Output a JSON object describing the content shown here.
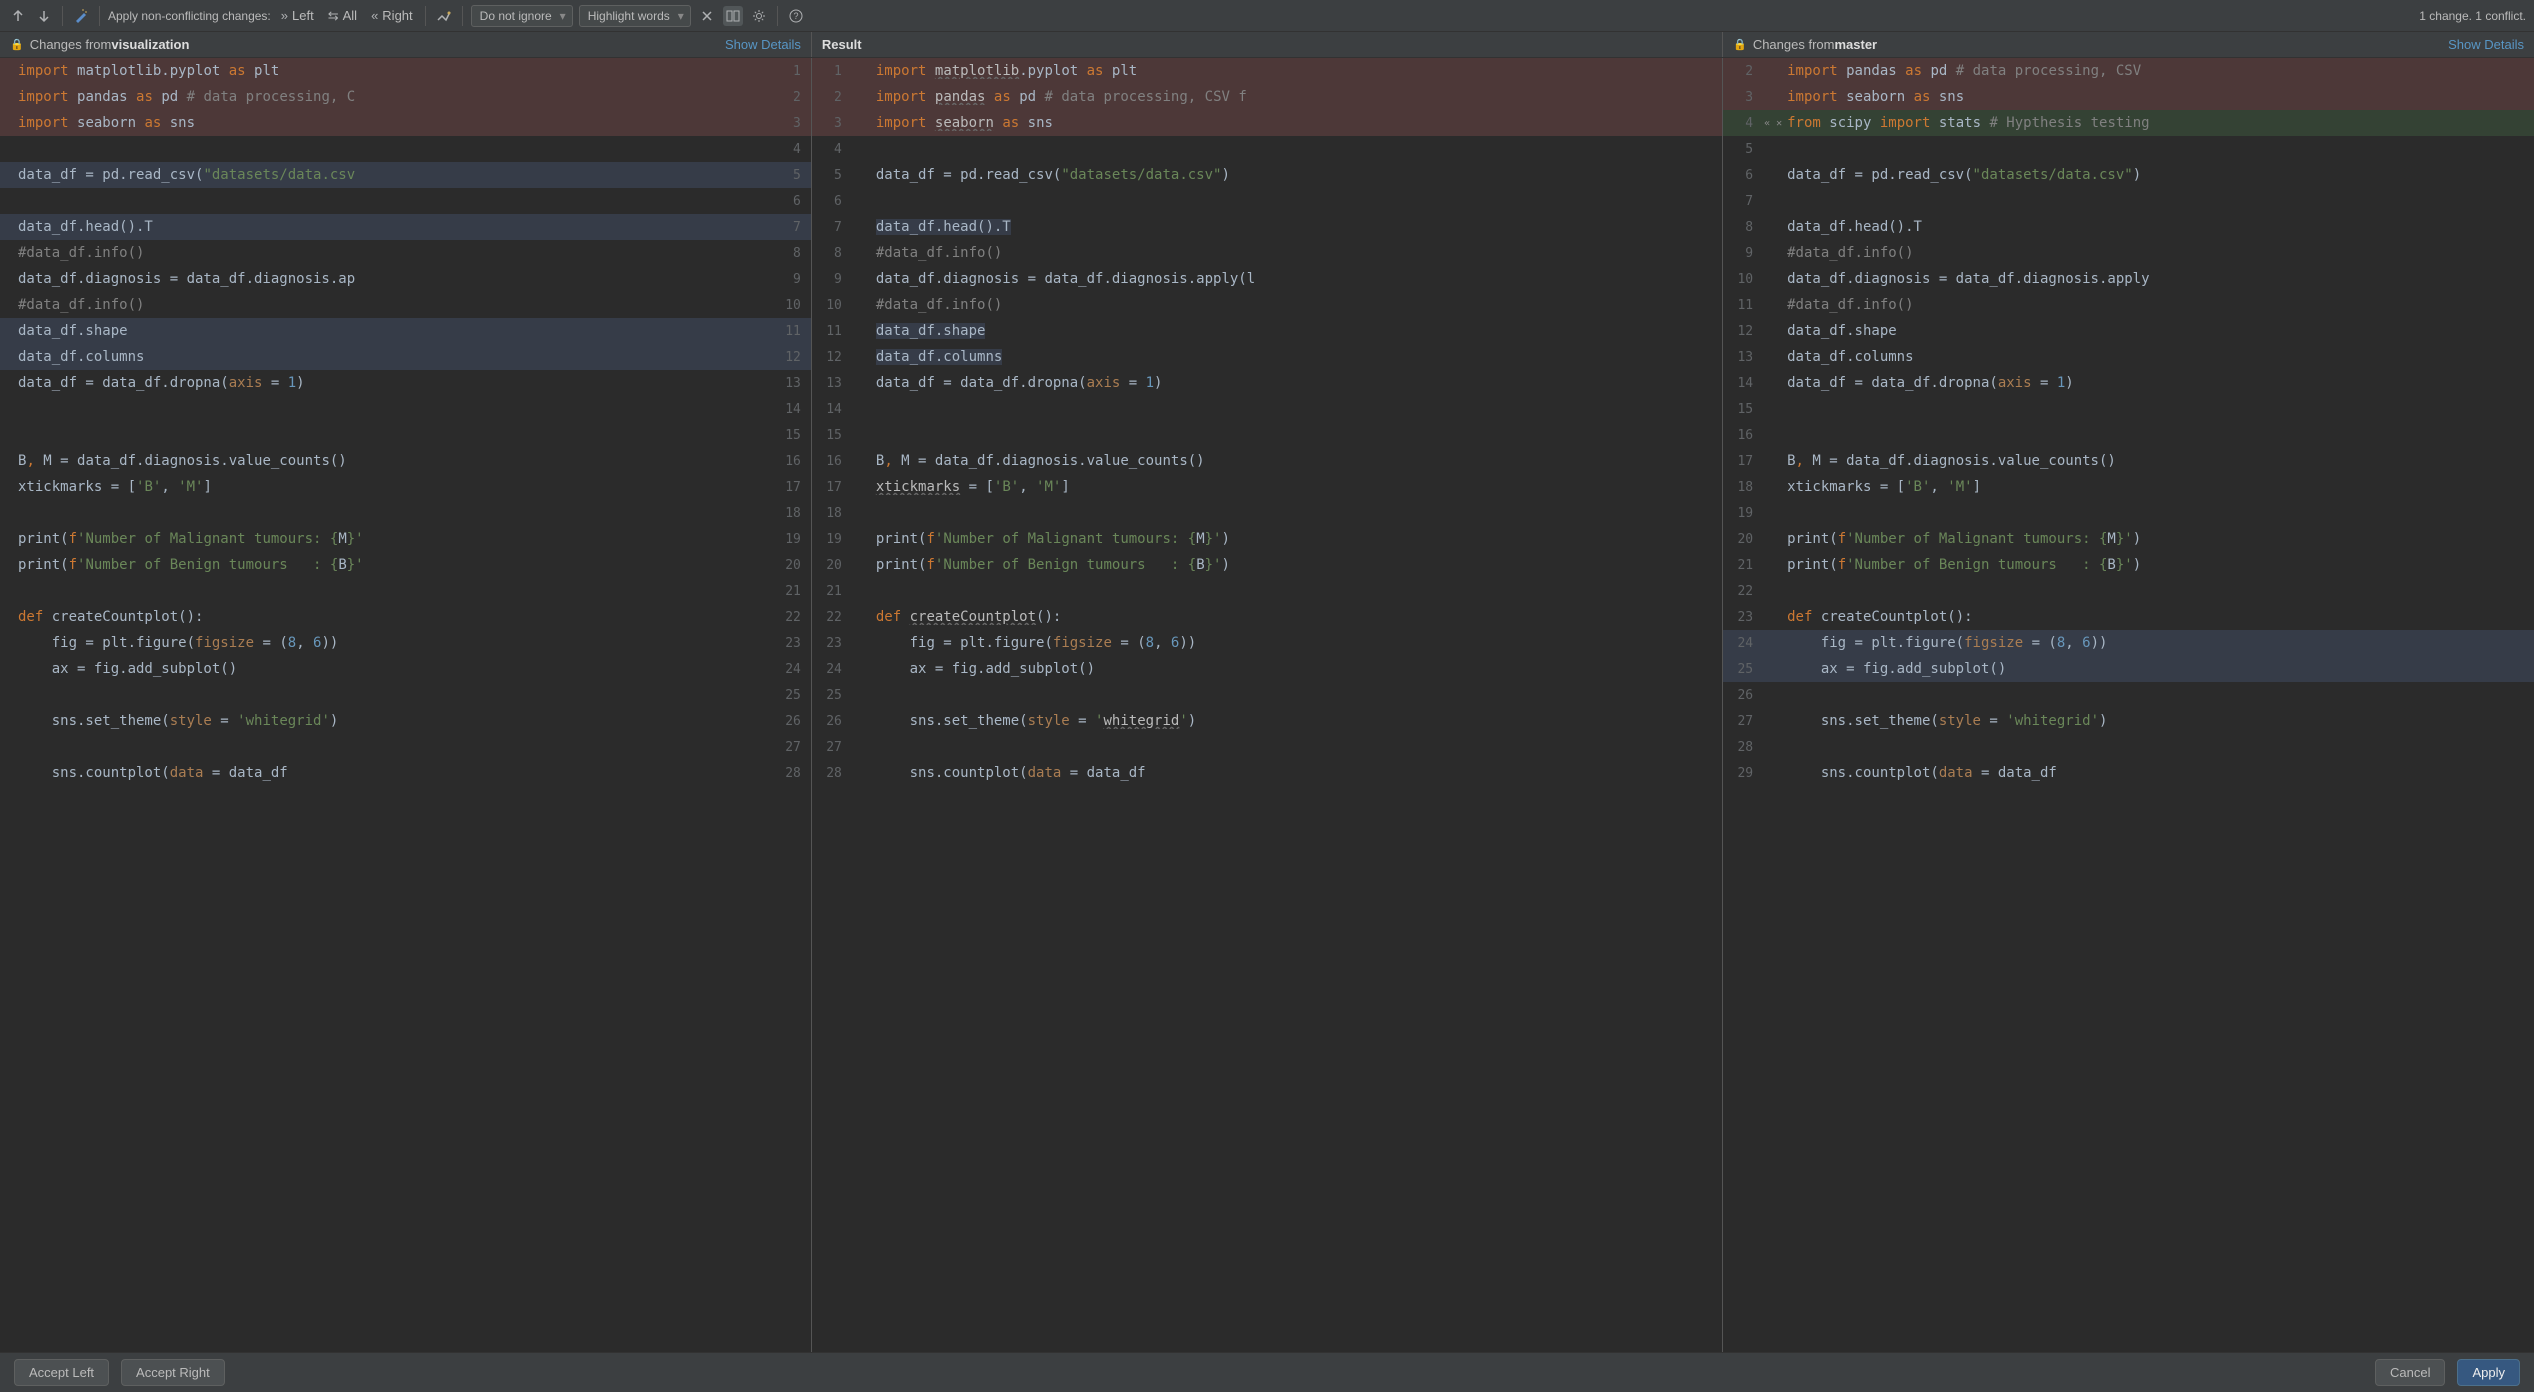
{
  "toolbar": {
    "apply_label": "Apply non-conflicting changes:",
    "left_label": "Left",
    "all_label": "All",
    "right_label": "Right",
    "ignore_dd": "Do not ignore",
    "highlight_dd": "Highlight words",
    "status": "1 change. 1 conflict."
  },
  "headers": {
    "left_prefix": "Changes from ",
    "left_branch": "visualization",
    "middle": "Result",
    "right_prefix": "Changes from ",
    "right_branch": "master",
    "show_details": "Show Details"
  },
  "left_lines": [
    {
      "n": 1,
      "bg": "conflict",
      "tokens": [
        [
          "kw",
          "import "
        ],
        [
          "ident",
          "matplotlib.pyplot "
        ],
        [
          "kw",
          "as "
        ],
        [
          "ident",
          "plt"
        ]
      ]
    },
    {
      "n": 2,
      "bg": "conflict",
      "tokens": [
        [
          "kw",
          "import "
        ],
        [
          "ident",
          "pandas "
        ],
        [
          "kw",
          "as "
        ],
        [
          "ident",
          "pd "
        ],
        [
          "comment",
          "# data processing, C"
        ]
      ]
    },
    {
      "n": 3,
      "bg": "conflict",
      "tokens": [
        [
          "kw",
          "import "
        ],
        [
          "ident",
          "seaborn "
        ],
        [
          "kw",
          "as "
        ],
        [
          "ident",
          "sns"
        ]
      ]
    },
    {
      "n": 4,
      "tokens": []
    },
    {
      "n": 5,
      "bg": "change",
      "tokens": [
        [
          "ident",
          "data_df = pd.read_csv("
        ],
        [
          "str",
          "\"datasets/data.csv"
        ]
      ]
    },
    {
      "n": 6,
      "tokens": []
    },
    {
      "n": 7,
      "bg": "change",
      "tokens": [
        [
          "ident",
          "data_df.head().T"
        ]
      ]
    },
    {
      "n": 8,
      "tokens": [
        [
          "comment",
          "#data_df.info()"
        ]
      ]
    },
    {
      "n": 9,
      "tokens": [
        [
          "ident",
          "data_df.diagnosis = data_df.diagnosis.ap"
        ]
      ]
    },
    {
      "n": 10,
      "tokens": [
        [
          "comment",
          "#data_df.info()"
        ]
      ]
    },
    {
      "n": 11,
      "bg": "change",
      "tokens": [
        [
          "ident",
          "data_df.shape"
        ]
      ]
    },
    {
      "n": 12,
      "bg": "change",
      "tokens": [
        [
          "ident",
          "data_df.columns"
        ]
      ]
    },
    {
      "n": 13,
      "tokens": [
        [
          "ident",
          "data_df = data_df.dropna("
        ],
        [
          "param",
          "axis"
        ],
        [
          "ident",
          " = "
        ],
        [
          "num",
          "1"
        ],
        [
          "ident",
          ")"
        ]
      ]
    },
    {
      "n": 14,
      "tokens": []
    },
    {
      "n": 15,
      "tokens": []
    },
    {
      "n": 16,
      "tokens": [
        [
          "ident",
          "B"
        ],
        [
          "kw",
          ", "
        ],
        [
          "ident",
          "M = data_df.diagnosis.value_counts()"
        ]
      ]
    },
    {
      "n": 17,
      "tokens": [
        [
          "ident",
          "xtickmarks = ["
        ],
        [
          "str",
          "'B'"
        ],
        [
          "ident",
          ", "
        ],
        [
          "str",
          "'M'"
        ],
        [
          "ident",
          "]"
        ]
      ]
    },
    {
      "n": 18,
      "tokens": []
    },
    {
      "n": 19,
      "tokens": [
        [
          "ident",
          "print("
        ],
        [
          "kw",
          "f"
        ],
        [
          "str",
          "'Number of Malignant tumours: {"
        ],
        [
          "ident",
          "M"
        ],
        [
          "str",
          "}'"
        ]
      ]
    },
    {
      "n": 20,
      "tokens": [
        [
          "ident",
          "print("
        ],
        [
          "kw",
          "f"
        ],
        [
          "str",
          "'Number of Benign tumours   : {"
        ],
        [
          "ident",
          "B"
        ],
        [
          "str",
          "}'"
        ]
      ]
    },
    {
      "n": 21,
      "tokens": []
    },
    {
      "n": 22,
      "tokens": [
        [
          "kw",
          "def "
        ],
        [
          "ident",
          "createCountplot():"
        ]
      ]
    },
    {
      "n": 23,
      "tokens": [
        [
          "ident",
          "    fig = plt.figure("
        ],
        [
          "param",
          "figsize"
        ],
        [
          "ident",
          " = ("
        ],
        [
          "num",
          "8"
        ],
        [
          "ident",
          ", "
        ],
        [
          "num",
          "6"
        ],
        [
          "ident",
          "))"
        ]
      ]
    },
    {
      "n": 24,
      "tokens": [
        [
          "ident",
          "    ax = fig.add_subplot()"
        ]
      ]
    },
    {
      "n": 25,
      "tokens": []
    },
    {
      "n": 26,
      "tokens": [
        [
          "ident",
          "    sns.set_theme("
        ],
        [
          "param",
          "style"
        ],
        [
          "ident",
          " = "
        ],
        [
          "str",
          "'whitegrid'"
        ],
        [
          "ident",
          ")"
        ]
      ]
    },
    {
      "n": 27,
      "tokens": []
    },
    {
      "n": 28,
      "tokens": [
        [
          "ident",
          "    sns.countplot("
        ],
        [
          "param",
          "data"
        ],
        [
          "ident",
          " = data_df"
        ]
      ]
    }
  ],
  "middle_lines": [
    {
      "nl": 1,
      "nr": 1,
      "bg": "conflict",
      "tokens": [
        [
          "kw",
          "import "
        ],
        [
          "dec-under",
          "matplotlib"
        ],
        [
          "ident",
          ".pyplot "
        ],
        [
          "kw",
          "as "
        ],
        [
          "ident",
          "plt"
        ]
      ]
    },
    {
      "nl": 2,
      "nr": 2,
      "bg": "conflict",
      "tokens": [
        [
          "kw",
          "import "
        ],
        [
          "dec-under",
          "pandas"
        ],
        [
          "ident",
          " "
        ],
        [
          "kw",
          "as "
        ],
        [
          "ident",
          "pd "
        ],
        [
          "comment",
          "# data processing, CSV f"
        ]
      ]
    },
    {
      "nl": 3,
      "nr": 3,
      "bg": "conflict",
      "tokens": [
        [
          "kw",
          "import "
        ],
        [
          "dec-under",
          "seaborn"
        ],
        [
          "ident",
          " "
        ],
        [
          "kw",
          "as "
        ],
        [
          "ident",
          "sns"
        ]
      ]
    },
    {
      "nl": 4,
      "nr": 4,
      "tokens": []
    },
    {
      "nl": 5,
      "nr": 5,
      "tokens": [
        [
          "ident",
          "data_df = pd.read_csv("
        ],
        [
          "str",
          "\"datasets/data.csv\""
        ],
        [
          "ident",
          ")"
        ]
      ]
    },
    {
      "nl": 6,
      "nr": 6,
      "tokens": []
    },
    {
      "nl": 7,
      "nr": 7,
      "tokens": [
        [
          "hl-change",
          "data_df.head().T"
        ]
      ]
    },
    {
      "nl": 8,
      "nr": 8,
      "tokens": [
        [
          "comment",
          "#data_df.info()"
        ]
      ]
    },
    {
      "nl": 9,
      "nr": 9,
      "tokens": [
        [
          "ident",
          "data_df.diagnosis = data_df.diagnosis.apply(l"
        ]
      ]
    },
    {
      "nl": 10,
      "nr": 10,
      "tokens": [
        [
          "comment",
          "#data_df.info()"
        ]
      ]
    },
    {
      "nl": 11,
      "nr": 11,
      "tokens": [
        [
          "hl-change",
          "data_df.shape"
        ]
      ]
    },
    {
      "nl": 12,
      "nr": 12,
      "tokens": [
        [
          "hl-change",
          "data_df.columns"
        ]
      ]
    },
    {
      "nl": 13,
      "nr": 13,
      "tokens": [
        [
          "ident",
          "data_df = data_df.dropna("
        ],
        [
          "param",
          "axis"
        ],
        [
          "ident",
          " = "
        ],
        [
          "num",
          "1"
        ],
        [
          "ident",
          ")"
        ]
      ]
    },
    {
      "nl": 14,
      "nr": 14,
      "tokens": []
    },
    {
      "nl": 15,
      "nr": 15,
      "tokens": []
    },
    {
      "nl": 16,
      "nr": 16,
      "tokens": [
        [
          "ident",
          "B"
        ],
        [
          "kw",
          ", "
        ],
        [
          "ident",
          "M = data_df.diagnosis.value_counts()"
        ]
      ]
    },
    {
      "nl": 17,
      "nr": 17,
      "tokens": [
        [
          "dec-under",
          "xtickmarks"
        ],
        [
          "ident",
          " = ["
        ],
        [
          "str",
          "'B'"
        ],
        [
          "ident",
          ", "
        ],
        [
          "str",
          "'M'"
        ],
        [
          "ident",
          "]"
        ]
      ]
    },
    {
      "nl": 18,
      "nr": 18,
      "tokens": []
    },
    {
      "nl": 19,
      "nr": 19,
      "tokens": [
        [
          "ident",
          "print("
        ],
        [
          "kw",
          "f"
        ],
        [
          "str",
          "'Number of Malignant tumours: {"
        ],
        [
          "ident",
          "M"
        ],
        [
          "str",
          "}'"
        ],
        [
          "ident",
          ")"
        ]
      ]
    },
    {
      "nl": 20,
      "nr": 20,
      "tokens": [
        [
          "ident",
          "print("
        ],
        [
          "kw",
          "f"
        ],
        [
          "str",
          "'Number of Benign tumours   : {"
        ],
        [
          "ident",
          "B"
        ],
        [
          "str",
          "}'"
        ],
        [
          "ident",
          ")"
        ]
      ]
    },
    {
      "nl": 21,
      "nr": 21,
      "tokens": []
    },
    {
      "nl": 22,
      "nr": 22,
      "tokens": [
        [
          "kw",
          "def "
        ],
        [
          "dec-under",
          "createCountplot"
        ],
        [
          "ident",
          "():"
        ]
      ]
    },
    {
      "nl": 23,
      "nr": 23,
      "tokens": [
        [
          "ident",
          "    fig = plt.figure("
        ],
        [
          "param",
          "figsize"
        ],
        [
          "ident",
          " = ("
        ],
        [
          "num",
          "8"
        ],
        [
          "ident",
          ", "
        ],
        [
          "num",
          "6"
        ],
        [
          "ident",
          "))"
        ]
      ]
    },
    {
      "nl": 24,
      "nr": 24,
      "tokens": [
        [
          "ident",
          "    ax = fig.add_subplot()"
        ]
      ]
    },
    {
      "nl": 25,
      "nr": 25,
      "tokens": []
    },
    {
      "nl": 26,
      "nr": 26,
      "tokens": [
        [
          "ident",
          "    sns.set_theme("
        ],
        [
          "param",
          "style"
        ],
        [
          "ident",
          " = "
        ],
        [
          "str",
          "'"
        ],
        [
          "dec-under",
          "whitegrid"
        ],
        [
          "str",
          "'"
        ],
        [
          "ident",
          ")"
        ]
      ]
    },
    {
      "nl": 27,
      "nr": 27,
      "tokens": []
    },
    {
      "nl": 28,
      "nr": 28,
      "tokens": [
        [
          "ident",
          "    sns.countplot("
        ],
        [
          "param",
          "data"
        ],
        [
          "ident",
          " = data_df"
        ]
      ]
    }
  ],
  "right_lines": [
    {
      "n": 2,
      "bg": "conflict",
      "tokens": [
        [
          "kw",
          "import "
        ],
        [
          "ident",
          "pandas "
        ],
        [
          "kw",
          "as "
        ],
        [
          "ident",
          "pd "
        ],
        [
          "comment",
          "# data processing, CSV "
        ]
      ]
    },
    {
      "n": 3,
      "bg": "conflict",
      "tokens": [
        [
          "kw",
          "import "
        ],
        [
          "ident",
          "seaborn "
        ],
        [
          "kw",
          "as "
        ],
        [
          "ident",
          "sns"
        ]
      ]
    },
    {
      "n": 4,
      "bg": "add",
      "tokens": [
        [
          "kw",
          "from "
        ],
        [
          "ident",
          "scipy "
        ],
        [
          "kw",
          "import "
        ],
        [
          "ident",
          "stats "
        ],
        [
          "comment",
          "# Hypthesis testing"
        ]
      ]
    },
    {
      "n": 5,
      "tokens": []
    },
    {
      "n": 6,
      "tokens": [
        [
          "ident",
          "data_df = pd.read_csv("
        ],
        [
          "str",
          "\"datasets/data.csv\""
        ],
        [
          "ident",
          ")"
        ]
      ]
    },
    {
      "n": 7,
      "tokens": []
    },
    {
      "n": 8,
      "tokens": [
        [
          "ident",
          "data_df.head().T"
        ]
      ]
    },
    {
      "n": 9,
      "tokens": [
        [
          "comment",
          "#data_df.info()"
        ]
      ]
    },
    {
      "n": 10,
      "tokens": [
        [
          "ident",
          "data_df.diagnosis = data_df.diagnosis.apply"
        ]
      ]
    },
    {
      "n": 11,
      "tokens": [
        [
          "comment",
          "#data_df.info()"
        ]
      ]
    },
    {
      "n": 12,
      "tokens": [
        [
          "ident",
          "data_df.shape"
        ]
      ]
    },
    {
      "n": 13,
      "tokens": [
        [
          "ident",
          "data_df.columns"
        ]
      ]
    },
    {
      "n": 14,
      "tokens": [
        [
          "ident",
          "data_df = data_df.dropna("
        ],
        [
          "param",
          "axis"
        ],
        [
          "ident",
          " = "
        ],
        [
          "num",
          "1"
        ],
        [
          "ident",
          ")"
        ]
      ]
    },
    {
      "n": 15,
      "tokens": []
    },
    {
      "n": 16,
      "tokens": []
    },
    {
      "n": 17,
      "tokens": [
        [
          "ident",
          "B"
        ],
        [
          "kw",
          ", "
        ],
        [
          "ident",
          "M = data_df.diagnosis.value_counts()"
        ]
      ]
    },
    {
      "n": 18,
      "tokens": [
        [
          "ident",
          "xtickmarks = ["
        ],
        [
          "str",
          "'B'"
        ],
        [
          "ident",
          ", "
        ],
        [
          "str",
          "'M'"
        ],
        [
          "ident",
          "]"
        ]
      ]
    },
    {
      "n": 19,
      "tokens": []
    },
    {
      "n": 20,
      "tokens": [
        [
          "ident",
          "print("
        ],
        [
          "kw",
          "f"
        ],
        [
          "str",
          "'Number of Malignant tumours: {"
        ],
        [
          "ident",
          "M"
        ],
        [
          "str",
          "}'"
        ],
        [
          "ident",
          ")"
        ]
      ]
    },
    {
      "n": 21,
      "tokens": [
        [
          "ident",
          "print("
        ],
        [
          "kw",
          "f"
        ],
        [
          "str",
          "'Number of Benign tumours   : {"
        ],
        [
          "ident",
          "B"
        ],
        [
          "str",
          "}'"
        ],
        [
          "ident",
          ")"
        ]
      ]
    },
    {
      "n": 22,
      "tokens": []
    },
    {
      "n": 23,
      "tokens": [
        [
          "kw",
          "def "
        ],
        [
          "ident",
          "createCountplot():"
        ]
      ]
    },
    {
      "n": 24,
      "bg": "change",
      "tokens": [
        [
          "ident",
          "    fig = plt.figure("
        ],
        [
          "param",
          "figsize"
        ],
        [
          "ident",
          " = ("
        ],
        [
          "num",
          "8"
        ],
        [
          "ident",
          ", "
        ],
        [
          "num",
          "6"
        ],
        [
          "ident",
          "))"
        ]
      ]
    },
    {
      "n": 25,
      "bg": "change",
      "tokens": [
        [
          "ident",
          "    ax = fig.add_subplot()"
        ]
      ]
    },
    {
      "n": 26,
      "tokens": []
    },
    {
      "n": 27,
      "tokens": [
        [
          "ident",
          "    sns.set_theme("
        ],
        [
          "param",
          "style"
        ],
        [
          "ident",
          " = "
        ],
        [
          "str",
          "'whitegrid'"
        ],
        [
          "ident",
          ")"
        ]
      ]
    },
    {
      "n": 28,
      "tokens": []
    },
    {
      "n": 29,
      "tokens": [
        [
          "ident",
          "    sns.countplot("
        ],
        [
          "param",
          "data"
        ],
        [
          "ident",
          " = data_df"
        ]
      ]
    }
  ],
  "footer": {
    "accept_left": "Accept Left",
    "accept_right": "Accept Right",
    "cancel": "Cancel",
    "apply": "Apply"
  }
}
